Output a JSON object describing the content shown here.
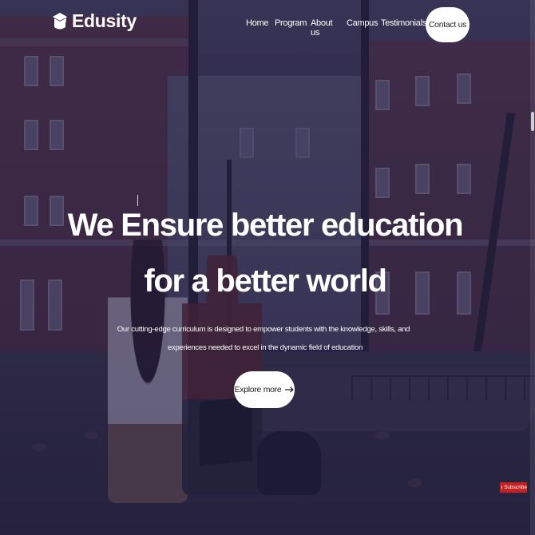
{
  "brand": {
    "name": "Edusity",
    "icon": "graduation-cap-icon"
  },
  "nav": {
    "items": [
      {
        "label": "Home"
      },
      {
        "label": "Program"
      },
      {
        "label": "About us"
      },
      {
        "label": "Campus"
      },
      {
        "label": "Testimonials"
      }
    ],
    "contact_label": "Contact us"
  },
  "hero": {
    "title_line1": "We Ensure better education",
    "title_line2": "for a better world",
    "subtitle_line1": "Our cutting-edge curriculum is designed to empower students with the knowledge, skills, and",
    "subtitle_line2": "experiences needed to excel in the dynamic field of education",
    "button_label": "Explore more",
    "button_icon": "arrow-right-icon"
  },
  "widget": {
    "subscribe_label": "Subscribe",
    "icon": "youtube-play-icon"
  },
  "colors": {
    "overlay": "#1c1840",
    "button_bg": "#ffffff",
    "text": "#ffffff",
    "subscribe_bg": "#c62121"
  }
}
